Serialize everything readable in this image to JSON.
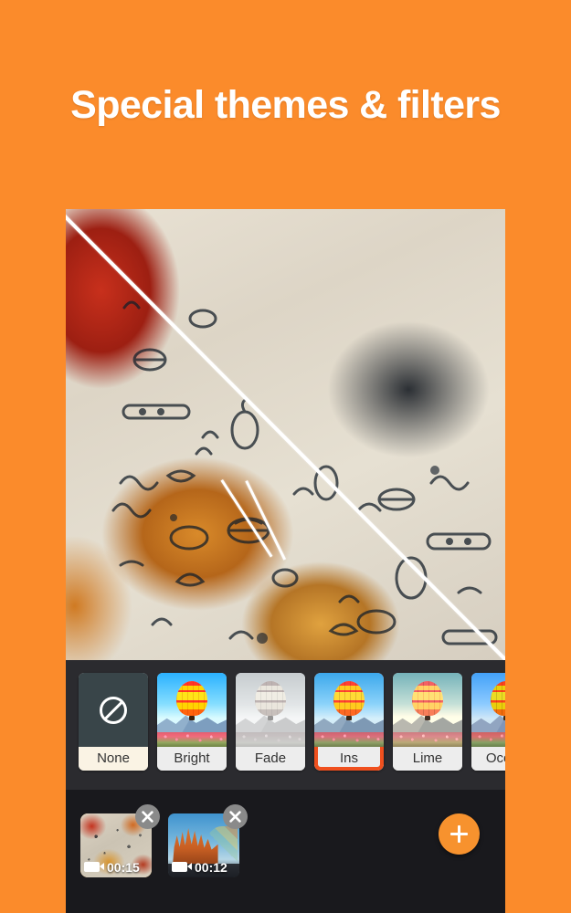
{
  "headline": "Special themes & filters",
  "colors": {
    "background_orange": "#FB8B2B",
    "panel_dark": "#2B2B2F",
    "timeline_dark": "#19191D",
    "selected_filter_border": "#F0501E",
    "selected_clip_border": "#F3A024",
    "fab_orange": "#F7922E"
  },
  "preview": {
    "name": "video-preview",
    "description": "Burgers and fries on patterned wrapper paper, split diagonally showing filtered and unfiltered halves"
  },
  "filters": {
    "selected": "Ins",
    "items": [
      {
        "label": "None",
        "icon": "no-symbol-icon",
        "variant": "none",
        "selected": false
      },
      {
        "label": "Bright",
        "icon": "balloon-thumb",
        "variant": "bright",
        "selected": false
      },
      {
        "label": "Fade",
        "icon": "balloon-thumb",
        "variant": "fade",
        "selected": false
      },
      {
        "label": "Ins",
        "icon": "balloon-thumb",
        "variant": "ins",
        "selected": true
      },
      {
        "label": "Lime",
        "icon": "balloon-thumb",
        "variant": "lime",
        "selected": false
      },
      {
        "label": "Ocean",
        "icon": "balloon-thumb",
        "variant": "ocean",
        "selected": false
      }
    ]
  },
  "timeline": {
    "clips": [
      {
        "duration": "00:15",
        "thumb": "food",
        "selected": true,
        "close_icon": "close-icon",
        "video_icon": "video-camera-icon"
      },
      {
        "duration": "00:12",
        "thumb": "cathedral",
        "selected": false,
        "close_icon": "close-icon",
        "video_icon": "video-camera-icon"
      }
    ],
    "add_button_icon": "plus-icon"
  }
}
